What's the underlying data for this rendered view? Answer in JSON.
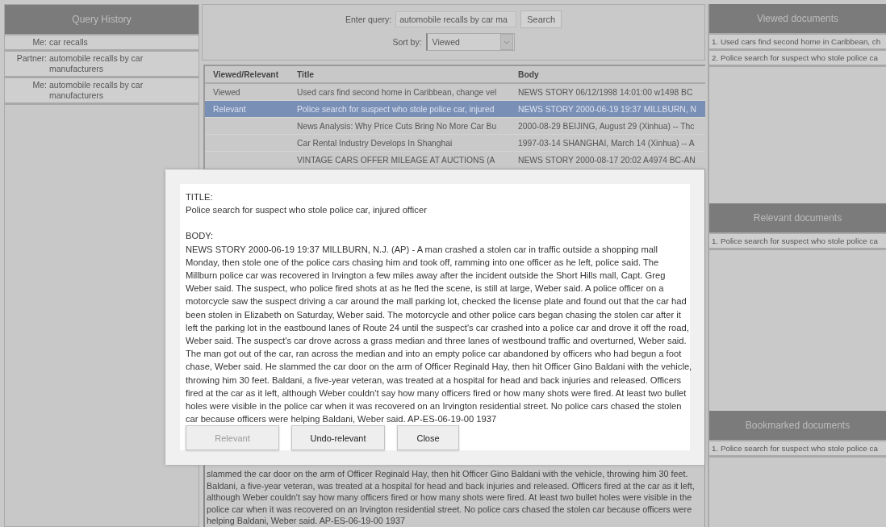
{
  "query_history": {
    "title": "Query History",
    "items": [
      {
        "speaker": "Me:",
        "query": "car recalls"
      },
      {
        "speaker": "Partner:",
        "query": "automobile recalls by car manufacturers"
      },
      {
        "speaker": "Me:",
        "query": "automobile recalls by car manufacturers"
      }
    ]
  },
  "search": {
    "label": "Enter query:",
    "value": "automobile recalls by car ma",
    "button": "Search"
  },
  "sort": {
    "label": "Sort by:",
    "value": "Viewed"
  },
  "results": {
    "columns": [
      "Viewed/Relevant",
      "Title",
      "Body"
    ],
    "rows": [
      {
        "status": "Viewed",
        "title": "Used cars find second home in Caribbean, change vel",
        "body": "NEWS STORY 06/12/1998 14:01:00 w1498 BC",
        "selected": false
      },
      {
        "status": "Relevant",
        "title": "Police search for suspect who stole police car, injured",
        "body": "NEWS STORY 2000-06-19 19:37 MILLBURN, N",
        "selected": true
      },
      {
        "status": "",
        "title": "News Analysis: Why Price Cuts Bring No More Car Bu",
        "body": "2000-08-29 BEIJING, August 29 (Xinhua) -- Thc",
        "selected": false
      },
      {
        "status": "",
        "title": "Car Rental Industry Develops In Shanghai",
        "body": "1997-03-14 SHANGHAI, March 14 (Xinhua) -- A",
        "selected": false
      },
      {
        "status": "",
        "title": "VINTAGE CARS OFFER MILEAGE AT AUCTIONS (A",
        "body": "NEWS STORY 2000-08-17 20:02 A4974 BC-AN",
        "selected": false
      }
    ]
  },
  "preview": {
    "text": "slammed the car door on the arm of Officer Reginald Hay, then hit Officer Gino Baldani with the vehicle, throwing him 30 feet. Baldani, a five-year veteran, was treated at a hospital for head and back injuries and released. Officers fired at the car as it left, although Weber couldn't say how many officers fired or how many shots were fired. At least two bullet holes were visible in the police car when it was recovered on an Irvington residential street. No police cars chased the stolen car because officers were helping Baldani, Weber said. AP-ES-06-19-00 1937"
  },
  "panels": [
    {
      "title": "Viewed documents",
      "items": [
        "1. Used cars find second home in Caribbean, ch",
        "2. Police search for suspect who stole police ca"
      ]
    },
    {
      "title": "Relevant documents",
      "items": [
        "1. Police search for suspect who stole police ca"
      ]
    },
    {
      "title": "Bookmarked documents",
      "items": [
        "1. Police search for suspect who stole police ca"
      ]
    }
  ],
  "dialog": {
    "title_label": "TITLE:",
    "title": "Police search for suspect who stole police car, injured officer",
    "body_label": "BODY:",
    "body": "NEWS STORY 2000-06-19 19:37 MILLBURN, N.J. (AP) - A man crashed a stolen car in traffic outside a shopping mall Monday, then stole one of the police cars chasing him and took off, ramming into one officer as he left, police said. The Millburn police car was recovered in Irvington a few miles away after the incident outside the Short Hills mall, Capt. Greg Weber said. The suspect, who police fired shots at as he fled the scene, is still at large, Weber said. A police officer on a motorcycle saw the suspect driving a car around the mall parking lot, checked the license plate and found out that the car had been stolen in Elizabeth on Saturday, Weber said. The motorcycle and other police cars began chasing the stolen car after it left the parking lot in the eastbound lanes of Route 24 until the suspect's car crashed into a police car and drove it off the road, Weber said. The suspect's car drove across a grass median and three lanes of westbound traffic and overturned, Weber said. The man got out of the car, ran across the median and into an empty police car abandoned by officers who had begun a foot chase, Weber said. He slammed the car door on the arm of Officer Reginald Hay, then hit Officer Gino Baldani with the vehicle, throwing him 30 feet. Baldani, a five-year veteran, was treated at a hospital for head and back injuries and released. Officers fired at the car as it left, although Weber couldn't say how many officers fired or how many shots were fired. At least two bullet holes were visible in the police car when it was recovered on an Irvington residential street. No police cars chased the stolen car because officers were helping Baldani, Weber said. AP-ES-06-19-00 1937",
    "buttons": [
      {
        "label": "Relevant",
        "disabled": true
      },
      {
        "label": "Undo-relevant",
        "disabled": false
      },
      {
        "label": "Close",
        "disabled": false
      }
    ]
  }
}
